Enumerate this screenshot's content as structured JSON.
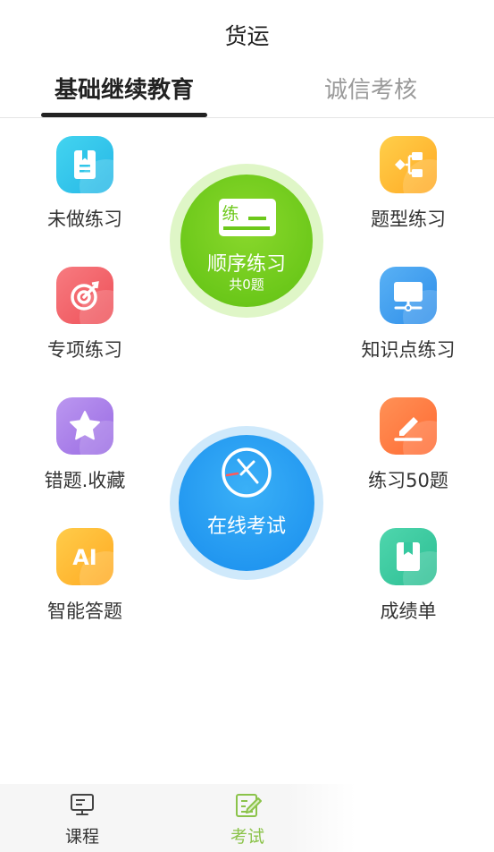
{
  "header": {
    "title": "货运"
  },
  "tabs": [
    {
      "label": "基础继续教育",
      "active": true
    },
    {
      "label": "诚信考核",
      "active": false
    }
  ],
  "features": {
    "unfinished": {
      "label": "未做练习",
      "icon": "notebook-icon",
      "color": "#2fc6e9"
    },
    "question_type": {
      "label": "题型练习",
      "icon": "structure-icon",
      "color": "#ffb830"
    },
    "special": {
      "label": "专项练习",
      "icon": "target-icon",
      "color": "#f2626a"
    },
    "knowledge": {
      "label": "知识点练习",
      "icon": "monitor-icon",
      "color": "#3b9af0"
    },
    "wrong_fav": {
      "label": "错题.收藏",
      "icon": "star-icon",
      "color": "#a57ae8"
    },
    "practice50": {
      "label": "练习50题",
      "icon": "pencil-icon",
      "color": "#ff7a42"
    },
    "ai": {
      "label": "智能答题",
      "icon": "ai-icon",
      "color": "#ffb92e",
      "icon_text": "AI"
    },
    "report": {
      "label": "成绩单",
      "icon": "bookmark-book-icon",
      "color": "#36c9a0"
    }
  },
  "sequential": {
    "label": "顺序练习",
    "count": "共0题",
    "badge": "练",
    "icon": "practice-card-icon",
    "color": "#6cc81a"
  },
  "online_exam": {
    "label": "在线考试",
    "icon": "clock-pen-icon",
    "color": "#2196f0"
  },
  "bottom_nav": [
    {
      "label": "课程",
      "icon": "monitor-course-icon",
      "active": false
    },
    {
      "label": "考试",
      "icon": "exam-edit-icon",
      "active": true,
      "color": "#8bc34a"
    }
  ]
}
